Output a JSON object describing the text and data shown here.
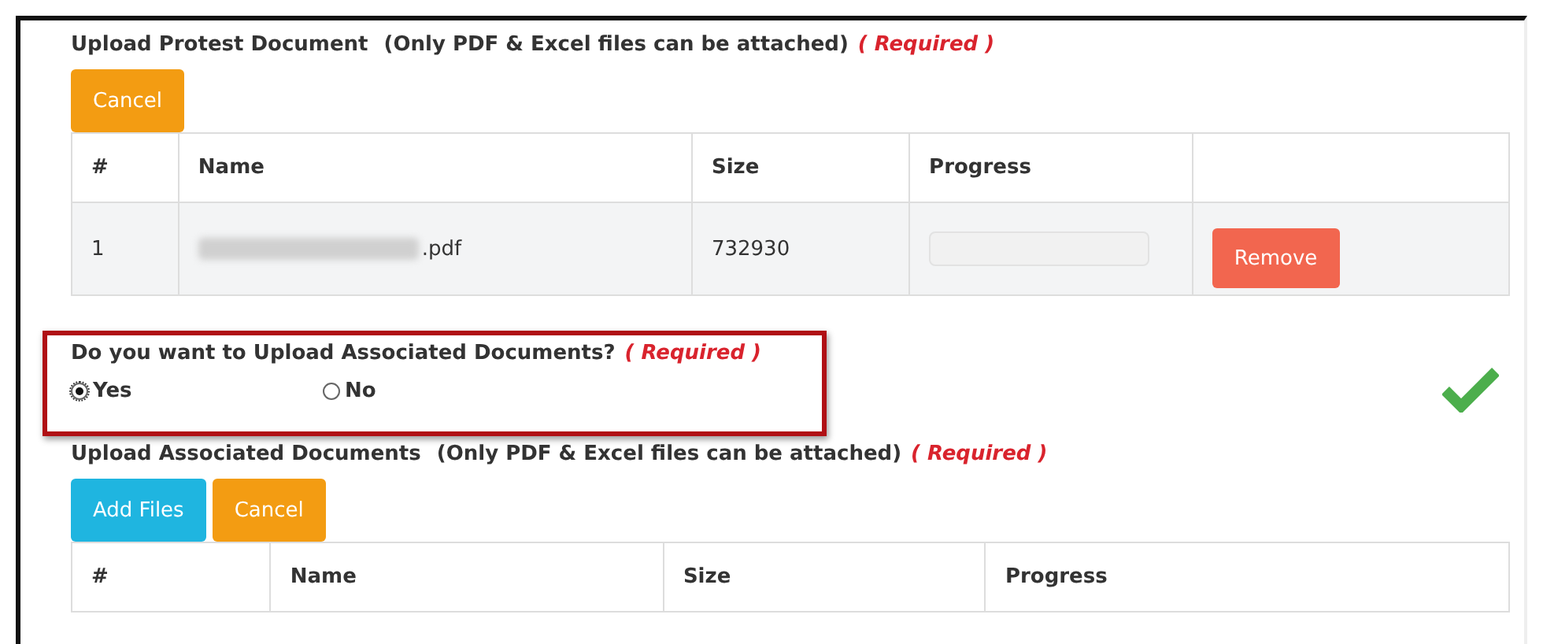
{
  "protest_upload": {
    "title": "Upload Protest Document",
    "note": "(Only PDF & Excel files can be attached)",
    "required": "( Required )",
    "buttons": [
      {
        "kind": "cancel",
        "label": "Cancel"
      }
    ],
    "table": {
      "columns": [
        "#",
        "Name",
        "Size",
        "Progress",
        ""
      ],
      "rows": [
        {
          "index": "1",
          "name": ".pdf",
          "size": "732930",
          "progress": {
            "level": 0
          },
          "action": "Remove"
        }
      ]
    }
  },
  "associated_question": {
    "question": "Do you want to Upload Associated Documents?",
    "required": "( Required )",
    "options": [
      {
        "label": "Yes",
        "selected": true
      },
      {
        "label": "No",
        "selected": false
      }
    ],
    "valid": true
  },
  "associated_upload": {
    "title": "Upload Associated Documents",
    "note": "(Only PDF & Excel files can be attached)",
    "required": "( Required )",
    "buttons": [
      {
        "kind": "add",
        "label": "Add Files"
      },
      {
        "kind": "cancel",
        "label": "Cancel"
      }
    ],
    "table": {
      "columns": [
        "#",
        "Name",
        "Size",
        "Progress"
      ]
    }
  }
}
